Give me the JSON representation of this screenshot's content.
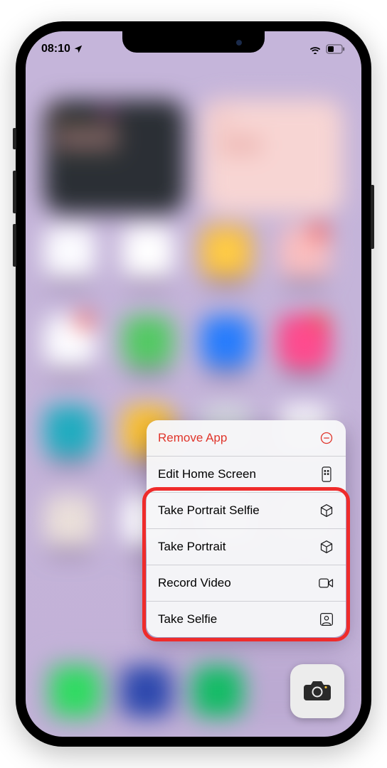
{
  "statusbar": {
    "time": "08:10"
  },
  "context_menu": {
    "items": [
      {
        "label": "Remove App",
        "icon": "remove-circle-icon"
      },
      {
        "label": "Edit Home Screen",
        "icon": "phone-layout-icon"
      },
      {
        "label": "Take Portrait Selfie",
        "icon": "cube-icon"
      },
      {
        "label": "Take Portrait",
        "icon": "cube-icon"
      },
      {
        "label": "Record Video",
        "icon": "video-camera-icon"
      },
      {
        "label": "Take Selfie",
        "icon": "person-square-icon"
      }
    ]
  },
  "highlighted_section": "camera quick actions",
  "focused_app": "Camera"
}
